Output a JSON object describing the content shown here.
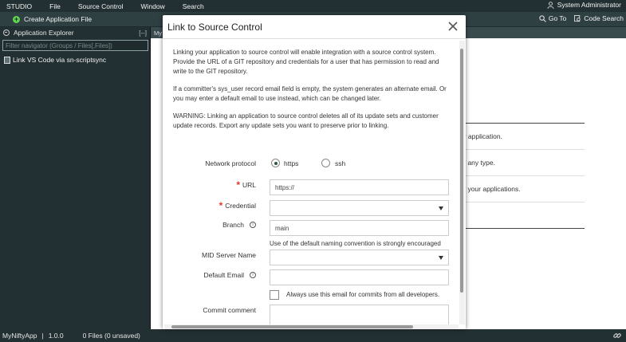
{
  "menubar": {
    "items": [
      "STUDIO",
      "File",
      "Source Control",
      "Window",
      "Search"
    ],
    "user": "System Administrator"
  },
  "toolbar": {
    "create_label": "Create Application File",
    "goto_label": "Go To",
    "code_search_label": "Code Search"
  },
  "explorer": {
    "title": "Application Explorer",
    "collapse_label": "[--]",
    "filter_placeholder": "Filter navigator (Groups / Files[,Files])",
    "items": [
      "Link VS Code via sn-scriptsync"
    ]
  },
  "main": {
    "tab_label": "My",
    "bg_lines": [
      "ur application.",
      "of any type.",
      "of your applications."
    ]
  },
  "modal": {
    "title": "Link to Source Control",
    "paragraphs": [
      "Linking your application to source control will enable integration with a source control system. Provide the URL of a GIT repository and credentials for a user that has permission to read and write to the GIT repository.",
      "If a committer's sys_user record email field is empty, the system generates an alternate email. Or you may enter a default email to use instead, which can be changed later.",
      "WARNING: Linking an application to source control deletes all of its update sets and customer update records. Export any update sets you want to preserve prior to linking."
    ],
    "fields": {
      "protocol_label": "Network protocol",
      "protocol_https": "https",
      "protocol_ssh": "ssh",
      "url_label": "URL",
      "url_value": "https://",
      "credential_label": "Credential",
      "credential_value": "",
      "branch_label": "Branch",
      "branch_value": "main",
      "branch_hint": "Use of the default naming convention is strongly encouraged",
      "mid_label": "MID Server Name",
      "mid_value": "",
      "email_label": "Default Email",
      "email_value": "",
      "always_email_label": "Always use this email for commits from all developers.",
      "comment_label": "Commit comment"
    }
  },
  "statusbar": {
    "app_name": "MyNiftyApp",
    "separator": "|",
    "version": "1.0.0",
    "files": "0 Files (0 unsaved)"
  },
  "colors": {
    "chrome_dark": "#233033",
    "accent_green": "#62d84e",
    "required_red": "#e03a2a"
  }
}
